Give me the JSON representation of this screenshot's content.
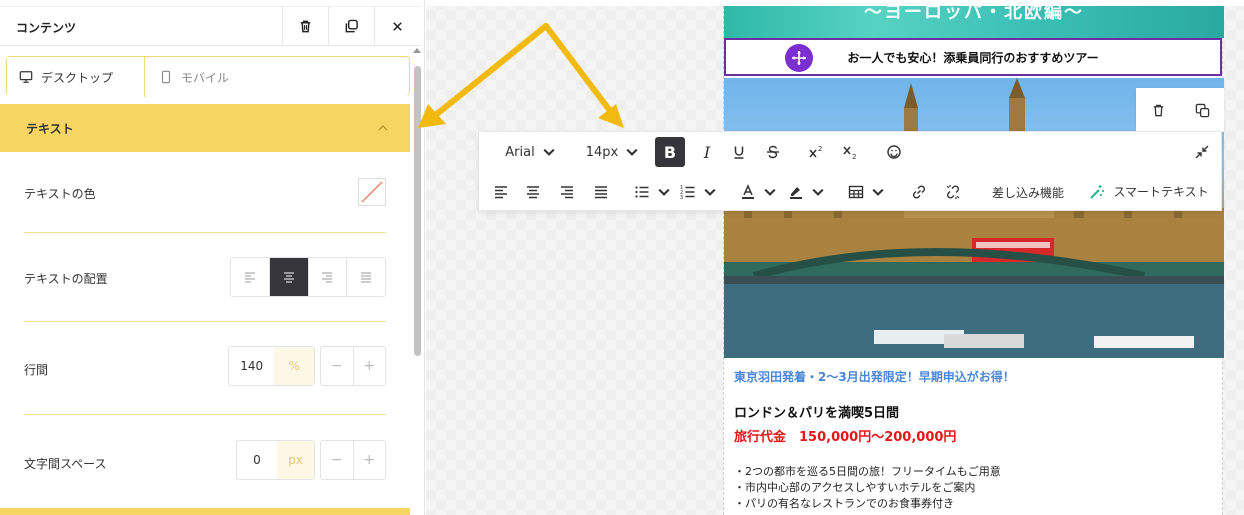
{
  "panel": {
    "title": "コンテンツ",
    "tabs": [
      {
        "label": "デスクトップ",
        "active": true
      },
      {
        "label": "モバイル",
        "active": false
      }
    ],
    "section_title": "テキスト",
    "text_color": {
      "label": "テキストの色"
    },
    "text_align": {
      "label": "テキストの配置",
      "options": [
        "left",
        "center",
        "right",
        "justify"
      ],
      "selected": "center"
    },
    "line_height": {
      "label": "行間",
      "value": "140",
      "unit": "%"
    },
    "letter_spacing": {
      "label": "文字間スペース",
      "value": "0",
      "unit": "px"
    },
    "stepper": {
      "minus": "−",
      "plus": "+"
    }
  },
  "toolbar": {
    "font_family": "Arial",
    "font_size": "14px",
    "bold": "B",
    "italic": "I",
    "merge_tags": "差し込み機能",
    "smart_text": "スマートテキスト"
  },
  "email": {
    "hero_text": "〜ヨーロッパ・北欧編〜",
    "subtitle": "お一人でも安心！添乗員同行のおすすめツアー",
    "promo": "東京羽田発着・2〜3月出発限定！早期申込がお得！",
    "tour_title": "ロンドン＆パリを満喫5日間",
    "price": "旅行代金　150,000円〜200,000円",
    "bullets": [
      "・2つの都市を巡る5日間の旅！フリータイムもご用意",
      "・市内中心部のアクセスしやすいホテルをご案内",
      "・パリの有名なレストランでのお食事券付き"
    ]
  },
  "colors": {
    "accent_yellow": "#f6d563",
    "dark_active": "#35353b",
    "selection_purple": "#6a2fa0",
    "promo_blue": "#4a86d8",
    "price_red": "#e01818",
    "arrow_orange": "#f2b90f"
  }
}
